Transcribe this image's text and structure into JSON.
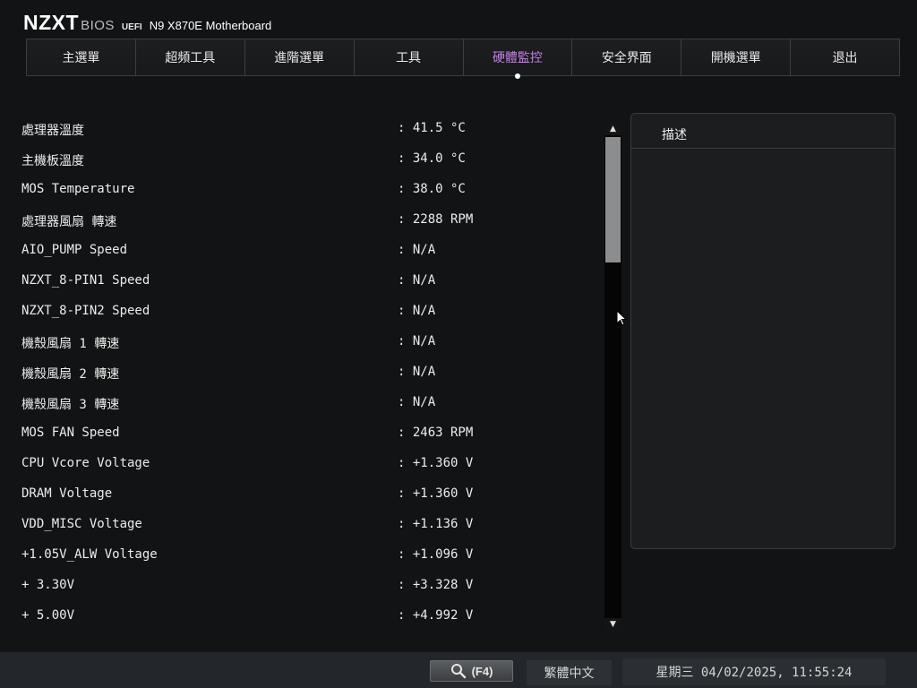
{
  "header": {
    "logo": "NZXT",
    "bios": "BIOS",
    "uefi": "UEFI",
    "model": "N9 X870E Motherboard"
  },
  "tabs": [
    {
      "label": "主選單",
      "active": false
    },
    {
      "label": "超頻工具",
      "active": false
    },
    {
      "label": "進階選單",
      "active": false
    },
    {
      "label": "工具",
      "active": false
    },
    {
      "label": "硬體監控",
      "active": true
    },
    {
      "label": "安全界面",
      "active": false
    },
    {
      "label": "開機選單",
      "active": false
    },
    {
      "label": "退出",
      "active": false
    }
  ],
  "sensors": [
    {
      "label": "處理器溫度",
      "value": ": 41.5 °C"
    },
    {
      "label": "主機板溫度",
      "value": ": 34.0 °C"
    },
    {
      "label": "MOS Temperature",
      "value": ": 38.0 °C"
    },
    {
      "label": "處理器風扇 轉速",
      "value": ": 2288 RPM"
    },
    {
      "label": "AIO_PUMP Speed",
      "value": ": N/A"
    },
    {
      "label": "NZXT_8-PIN1 Speed",
      "value": ": N/A"
    },
    {
      "label": "NZXT_8-PIN2 Speed",
      "value": ": N/A"
    },
    {
      "label": "機殼風扇 1 轉速",
      "value": ": N/A"
    },
    {
      "label": "機殼風扇 2 轉速",
      "value": ": N/A"
    },
    {
      "label": "機殼風扇 3 轉速",
      "value": ": N/A"
    },
    {
      "label": "MOS FAN Speed",
      "value": ": 2463 RPM"
    },
    {
      "label": "CPU Vcore Voltage",
      "value": ": +1.360 V"
    },
    {
      "label": "DRAM Voltage",
      "value": ": +1.360 V"
    },
    {
      "label": "VDD_MISC Voltage",
      "value": ": +1.136 V"
    },
    {
      "label": "+1.05V_ALW Voltage",
      "value": ": +1.096 V"
    },
    {
      "label": "+ 3.30V",
      "value": ": +3.328 V"
    },
    {
      "label": "+ 5.00V",
      "value": ": +4.992 V"
    }
  ],
  "description": {
    "title": "描述"
  },
  "footer": {
    "search_key": "(F4)",
    "language": "繁體中文",
    "datetime": "星期三 04/02/2025, 11:55:24"
  },
  "colors": {
    "active_tab": "#c77fe8",
    "background": "#121314"
  },
  "icons": {
    "search": "magnifier-icon",
    "scroll_up": "triangle-up-icon",
    "scroll_down": "triangle-down-icon",
    "cursor": "mouse-pointer-icon"
  }
}
